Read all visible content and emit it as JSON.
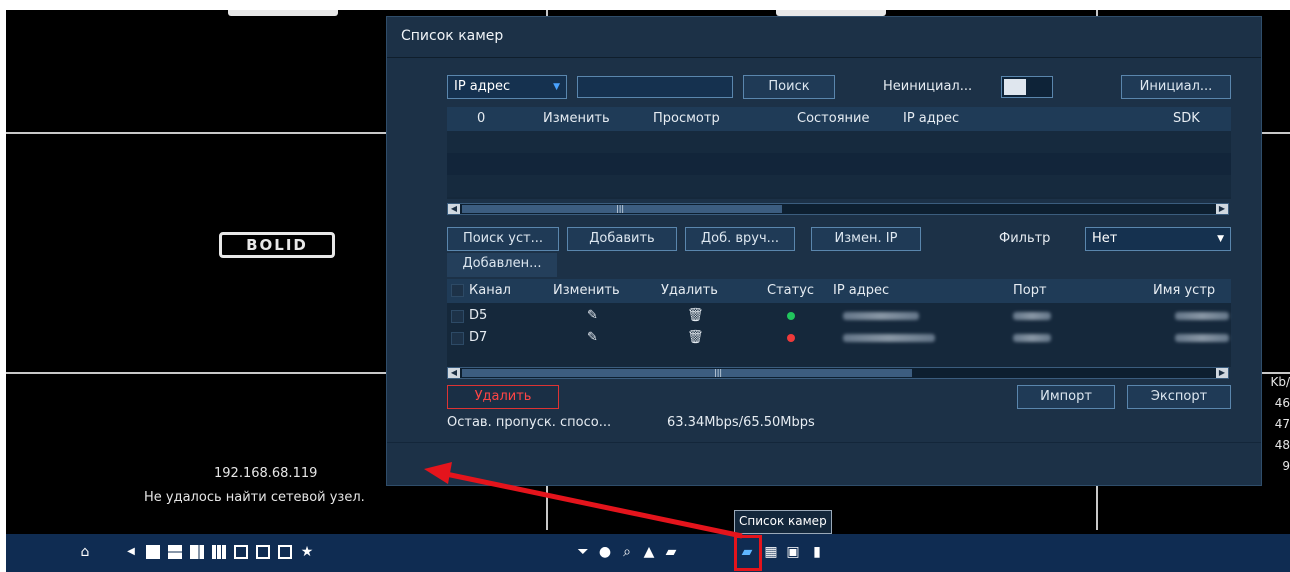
{
  "background": {
    "logo_text": "BOLID",
    "ip_address": "192.168.68.119",
    "error_text": "Не удалось найти сетевой узел.",
    "stats": [
      "Kb/",
      "46",
      "47",
      "48",
      "9"
    ]
  },
  "dialog": {
    "title": "Список камер",
    "top_bar": {
      "filter_select": "IP адрес",
      "search_value": "",
      "search_button": "Поиск",
      "uninit_label": "Неинициал...",
      "init_button": "Инициал..."
    },
    "search_table": {
      "headers": [
        "0",
        "Изменить",
        "Просмотр",
        "Состояние",
        "IP адрес",
        "SDK"
      ]
    },
    "buttons": {
      "search_devices": "Поиск уст...",
      "add": "Добавить",
      "add_manual": "Доб. вруч...",
      "change_ip": "Измен. IP",
      "filter_label": "Фильтр",
      "filter_value": "Нет",
      "added_tab": "Добавлен..."
    },
    "added_table": {
      "headers": [
        "Канал",
        "Изменить",
        "Удалить",
        "Статус",
        "IP адрес",
        "Порт",
        "Имя устр"
      ],
      "rows": [
        {
          "channel": "D5",
          "status_color": "#21c55d"
        },
        {
          "channel": "D7",
          "status_color": "#ef3a3a"
        }
      ]
    },
    "bottom": {
      "delete_button": "Удалить",
      "import_button": "Импорт",
      "export_button": "Экспорт",
      "bandwidth_label": "Остав. пропуск. спосо...",
      "bandwidth_value": "63.34Mbps/65.50Mbps"
    }
  },
  "taskbar": {
    "tooltip": "Список камер",
    "icons": [
      "home-icon",
      "prev-icon",
      "layout-1-icon",
      "layout-4-icon",
      "layout-8-icon",
      "layout-9-icon",
      "layout-16-icon",
      "layout-custom-icon",
      "layout-edit-icon",
      "favorite-icon",
      "ptz-icon",
      "color-icon",
      "search-icon",
      "alarm-icon",
      "camera-icon",
      "camera-list-icon",
      "network-icon",
      "hdd-icon",
      "usb-icon"
    ]
  },
  "colors": {
    "dialog_bg": "#1c3147",
    "taskbar_bg": "#0f2c52",
    "highlight_red": "#e4141c"
  }
}
